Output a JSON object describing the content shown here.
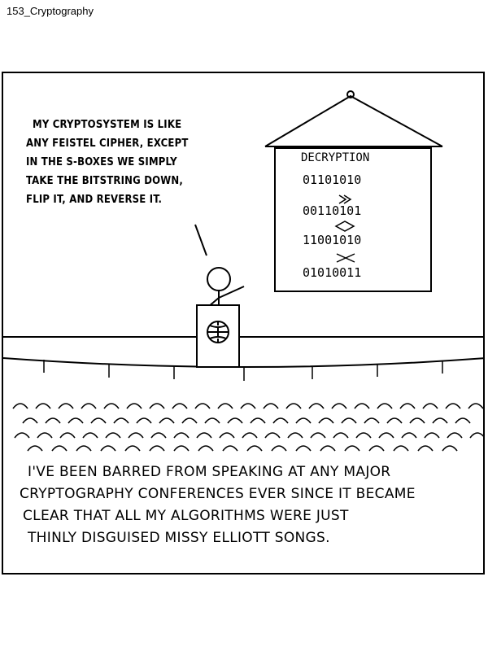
{
  "header": {
    "title": "153_Cryptography"
  },
  "speech": {
    "lines": [
      "MY CRYPTOSYSTEM IS LIKE",
      "ANY FEISTEL CIPHER, EXCEPT",
      "IN THE S-BOXES WE SIMPLY",
      "TAKE THE BITSTRING DOWN,",
      "FLIP IT, AND REVERSE IT."
    ]
  },
  "poster": {
    "title": "DECRYPTION",
    "rows": [
      "01101010",
      "00110101",
      "11001010",
      "01010011"
    ]
  },
  "caption": {
    "lines": [
      "I'VE BEEN BARRED FROM SPEAKING AT ANY MAJOR",
      "CRYPTOGRAPHY CONFERENCES EVER SINCE IT BECAME",
      "CLEAR THAT ALL MY ALGORITHMS WERE JUST",
      "THINLY DISGUISED MISSY ELLIOTT SONGS."
    ]
  }
}
